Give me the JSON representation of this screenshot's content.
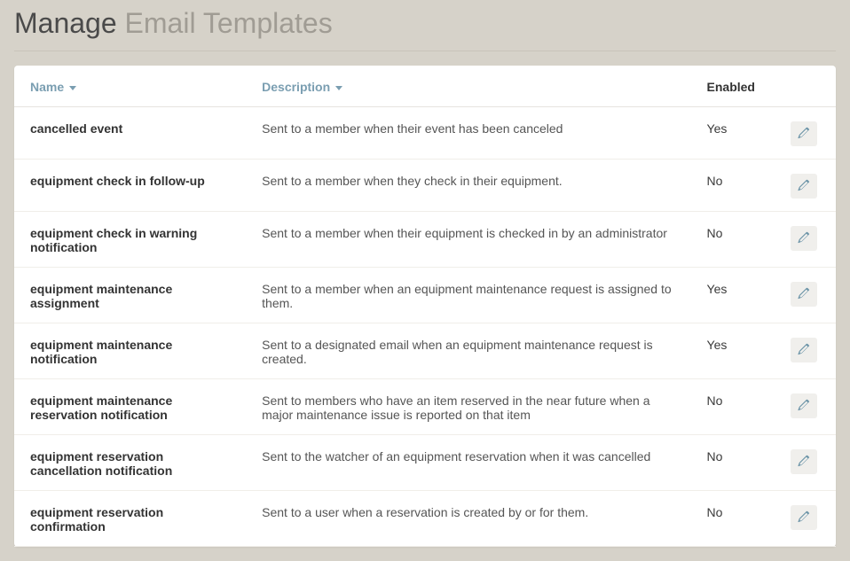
{
  "header": {
    "title_main": "Manage",
    "title_sub": "Email Templates"
  },
  "table": {
    "columns": {
      "name": "Name",
      "description": "Description",
      "enabled": "Enabled"
    },
    "rows": [
      {
        "name": "cancelled event",
        "description": "Sent to a member when their event has been canceled",
        "enabled": "Yes"
      },
      {
        "name": "equipment check in follow-up",
        "description": "Sent to a member when they check in their equipment.",
        "enabled": "No"
      },
      {
        "name": "equipment check in warning notification",
        "description": "Sent to a member when their equipment is checked in by an administrator",
        "enabled": "No"
      },
      {
        "name": "equipment maintenance assignment",
        "description": "Sent to a member when an equipment maintenance request is assigned to them.",
        "enabled": "Yes"
      },
      {
        "name": "equipment maintenance notification",
        "description": "Sent to a designated email when an equipment maintenance request is created.",
        "enabled": "Yes"
      },
      {
        "name": "equipment maintenance reservation notification",
        "description": "Sent to members who have an item reserved in the near future when a major maintenance issue is reported on that item",
        "enabled": "No"
      },
      {
        "name": "equipment reservation cancellation notification",
        "description": "Sent to the watcher of an equipment reservation when it was cancelled",
        "enabled": "No"
      },
      {
        "name": "equipment reservation confirmation",
        "description": "Sent to a user when a reservation is created by or for them.",
        "enabled": "No"
      }
    ]
  }
}
